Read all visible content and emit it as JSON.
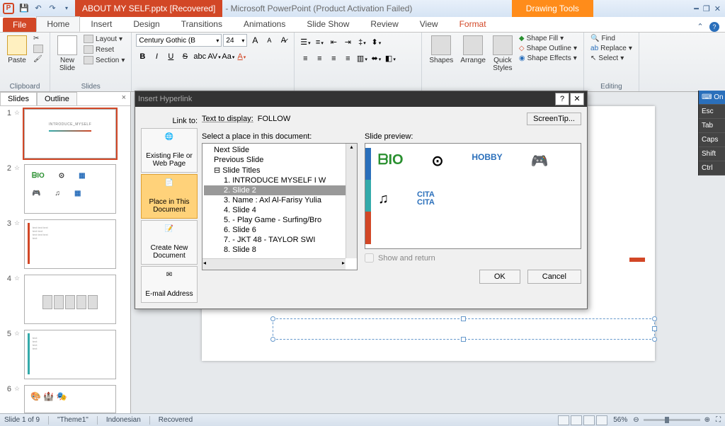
{
  "titlebar": {
    "doc_title": "ABOUT MY SELF.pptx [Recovered]",
    "app_title": " - Microsoft PowerPoint (Product Activation Failed)",
    "context_tab": "Drawing Tools"
  },
  "ribbon": {
    "file": "File",
    "tabs": [
      "Home",
      "Insert",
      "Design",
      "Transitions",
      "Animations",
      "Slide Show",
      "Review",
      "View",
      "Format"
    ],
    "active_tab": "Home",
    "groups": {
      "clipboard": {
        "label": "Clipboard",
        "paste": "Paste"
      },
      "slides": {
        "label": "Slides",
        "new_slide": "New\nSlide",
        "layout": "Layout",
        "reset": "Reset",
        "section": "Section"
      },
      "font": {
        "label": "",
        "family": "Century Gothic (B",
        "size": "24"
      },
      "paragraph": {
        "label": ""
      },
      "drawing": {
        "label": "",
        "shapes": "Shapes",
        "arrange": "Arrange",
        "quick_styles": "Quick\nStyles",
        "fill": "Shape Fill",
        "outline": "Shape Outline",
        "effects": "Shape Effects"
      },
      "editing": {
        "label": "Editing",
        "find": "Find",
        "replace": "Replace",
        "select": "Select"
      }
    }
  },
  "slides_panel": {
    "tabs": [
      "Slides",
      "Outline"
    ],
    "thumbs": [
      {
        "n": "1",
        "title": "INTRODUCE_MYSELF"
      },
      {
        "n": "2"
      },
      {
        "n": "3"
      },
      {
        "n": "4"
      },
      {
        "n": "5"
      },
      {
        "n": "6"
      }
    ]
  },
  "dialog": {
    "title": "Insert Hyperlink",
    "link_to_label": "Link to:",
    "text_display_label": "Text to display:",
    "text_display_value": "FOLLOW",
    "screentip": "ScreenTip...",
    "link_options": [
      "Existing File or Web Page",
      "Place in This Document",
      "Create New Document",
      "E-mail Address"
    ],
    "select_label": "Select a place in this document:",
    "tree": [
      {
        "l": 1,
        "t": "Next Slide"
      },
      {
        "l": 1,
        "t": "Previous Slide"
      },
      {
        "l": 1,
        "t": "Slide Titles",
        "expand": "⊟"
      },
      {
        "l": 2,
        "t": "1. INTRODUCE MYSELF I W"
      },
      {
        "l": 2,
        "t": "2. Slide 2",
        "sel": true
      },
      {
        "l": 2,
        "t": "3. Name  : Axl Al-Farisy Yulia"
      },
      {
        "l": 2,
        "t": "4. Slide 4"
      },
      {
        "l": 2,
        "t": "5. - Play Game  - Surfing/Bro"
      },
      {
        "l": 2,
        "t": "6. Slide 6"
      },
      {
        "l": 2,
        "t": "7. - JKT 48  - TAYLOR  SWI"
      },
      {
        "l": 2,
        "t": "8. Slide 8"
      }
    ],
    "preview_label": "Slide preview:",
    "show_return": "Show and return",
    "ok": "OK",
    "cancel": "Cancel"
  },
  "osk": {
    "items": [
      "On",
      "Esc",
      "Tab",
      "Caps",
      "Shift",
      "Ctrl"
    ]
  },
  "status": {
    "slide": "Slide 1 of 9",
    "theme": "\"Theme1\"",
    "lang": "Indonesian",
    "recovered": "Recovered",
    "zoom": "56%"
  }
}
